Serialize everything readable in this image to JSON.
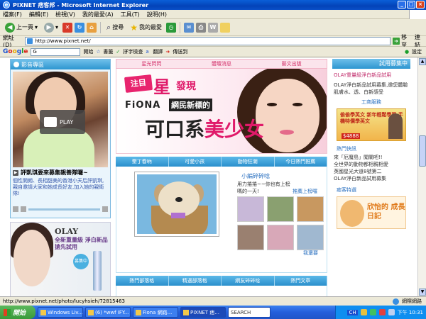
{
  "window": {
    "title": "PIXNET 痞客邦 - Microsoft Internet Explorer",
    "ie_logo": "e"
  },
  "menu": [
    "檔案(F)",
    "編輯(E)",
    "檢視(V)",
    "我的最愛(A)",
    "工具(T)",
    "說明(H)"
  ],
  "toolbar": {
    "back_label": "上一頁",
    "search_label": "搜尋",
    "favorites_label": "我的最愛"
  },
  "address": {
    "label": "網址(D)",
    "url": "http://www.pixnet.net/",
    "go_label": "移至",
    "links_label": "連結"
  },
  "googlebar": {
    "logo": "Google",
    "search_placeholder": "G",
    "start_label": "開始",
    "bookmarks_label": "書籤",
    "spellcheck_label": "拼字檢查",
    "translate_label": "翻譯",
    "sendto_label": "傳送到",
    "settings_label": "設定"
  },
  "video_panel": {
    "header": "影音專區",
    "play_label": "PLAY",
    "title": "評凱琪要來募集親善隊囉~",
    "description": "個性開朗、長相甜美的香港小天后評凱琪,親自邀請大家和她成長好友,加入她的親衛隊!"
  },
  "olay_ad": {
    "logo": "OLAY",
    "subtitle": "全新重量級 淨白新品搶先試用",
    "badge": "募集中"
  },
  "center_tabs": [
    "星光閃閃",
    "體壇消息",
    "藝文出版"
  ],
  "banner": {
    "ribbon": "注目",
    "star": "星",
    "discover": "發現",
    "fiona": "FiONA",
    "netnew": "網民新標的",
    "kekou1": "可口系",
    "kekou2": "美少女"
  },
  "photo_tabs": [
    "墾丁春吶",
    "可愛小孩",
    "動物狂潮",
    "今日熱門推薦"
  ],
  "photo_section": {
    "editor_title": "小編碎碎唸",
    "editor_text": "用力捲捲~~你也有上榜嗎的一天!",
    "hot_link": "推薦上榜囉",
    "more_link": "我還要"
  },
  "blog_tabs": [
    "熱門部落格",
    "精選部落格",
    "網友碎碎唸",
    "熱門文章"
  ],
  "right_col": {
    "header": "試用募集中",
    "olay_text": "OLAY重量級淨白新品試用",
    "olay_desc": "OLAY淨白新品試用募集,邀您體驗肌膚水、透、白新感受",
    "service_link": "工商服務",
    "english_ad": "偷偷學英文 新年輕鬆學習 手機特價學英文",
    "english_price": "$4888",
    "hot_title": "熱門快訊",
    "hot_items": [
      "來「厄魔島」闖關吧!!",
      "全世界的動物都相親相愛",
      "英國星光大道8號第二",
      "OLAY淨白新品試用募集"
    ],
    "special_title": "癒客特選",
    "diary_title": "欣怡的 成長日記"
  },
  "status": {
    "url": "http://www.pixnet.net/photo/lucyhsieh/72815463",
    "zone": "網際網路"
  },
  "taskbar": {
    "start": "開始",
    "tasks": [
      "Windows Liv...",
      "(6) *wwf IFY...",
      "Fiona 網路...",
      "PIXNET 痞..."
    ],
    "search_label": "SEARCH",
    "lang": "CH",
    "clock": "下午 10:31"
  }
}
